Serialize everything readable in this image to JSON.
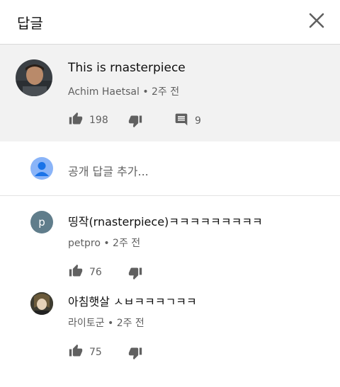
{
  "header": {
    "title": "답글"
  },
  "main_comment": {
    "text": "This is rnasterpiece",
    "author": "Achim Haetsal",
    "time": "• 2주 전",
    "likes": "198",
    "replies": "9"
  },
  "add_reply": {
    "placeholder": "공개 답글 추가..."
  },
  "replies": [
    {
      "avatar_letter": "p",
      "text": "띵작(rnasterpiece)ㅋㅋㅋㅋㅋㅋㅋㅋㅋ",
      "author": "petpro",
      "time": "• 2주 전",
      "likes": "76"
    },
    {
      "text": "아침햇살 ㅅㅂㅋㅋㅋㄱㅋㅋ",
      "author": "라이토군",
      "time": "• 2주 전",
      "likes": "75"
    }
  ],
  "colors": {
    "avatar_p": "#607d8b",
    "avatar_default": "#8ab4f8",
    "meta": "#606060"
  },
  "icons": [
    "close-icon",
    "thumb-up-icon",
    "thumb-down-icon",
    "comment-icon",
    "account-icon"
  ]
}
